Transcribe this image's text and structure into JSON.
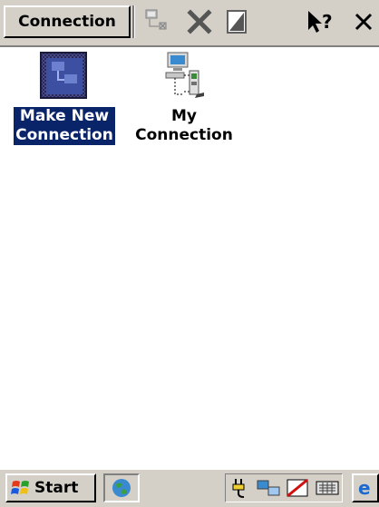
{
  "toolbar": {
    "connection_label": "Connection",
    "icons": [
      "properties-icon",
      "delete-icon",
      "copy-icon",
      "help-icon",
      "close-icon"
    ]
  },
  "items": [
    {
      "label": "Make New\nConnection",
      "icon": "make-new-connection-icon",
      "selected": true
    },
    {
      "label": "My\nConnection",
      "icon": "network-connection-icon",
      "selected": false
    }
  ],
  "taskbar": {
    "start_label": "Start",
    "tray_icons": [
      "power-plug-icon",
      "network-icon",
      "input-panel-icon",
      "keyboard-icon"
    ]
  },
  "colors": {
    "selection": "#0a246a",
    "chrome": "#d4d0c8"
  }
}
